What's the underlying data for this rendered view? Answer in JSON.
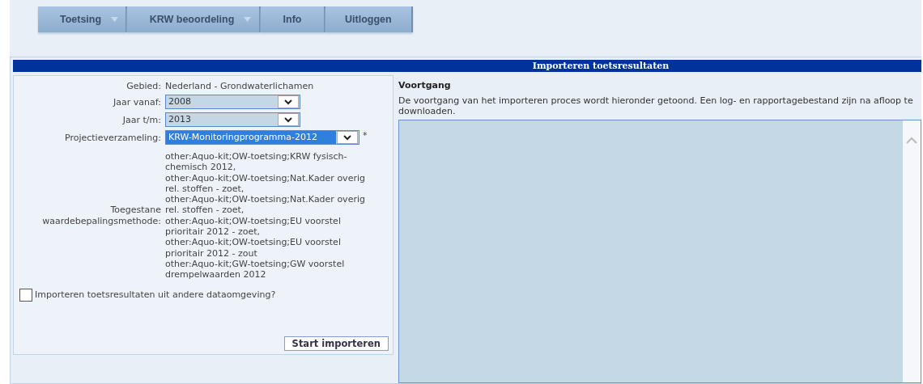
{
  "menu": [
    {
      "label": "Toetsing",
      "has_dropdown": true
    },
    {
      "label": "KRW beoordeling",
      "has_dropdown": true
    },
    {
      "label": "Info",
      "has_dropdown": false
    },
    {
      "label": "Uitloggen",
      "has_dropdown": false
    }
  ],
  "panel_title": "Importeren toetsresultaten",
  "form": {
    "area_label": "Gebied:",
    "area_value": "Nederland - Grondwaterlichamen",
    "selects": [
      {
        "label": "Jaar vanaf:",
        "value": "2008",
        "highlighted": false
      },
      {
        "label": "Jaar t/m:",
        "value": "2013",
        "highlighted": false
      },
      {
        "label": "Projectieverzameling:",
        "value": "KRW-Monitoringprogramma-2012",
        "highlighted": true,
        "required_mark": "*"
      }
    ],
    "methods_label": "Toegestane waardebepalingsmethode:",
    "methods": [
      "other:Aquo-kit;OW-toetsing;KRW fysisch-chemisch 2012,",
      "other:Aquo-kit;OW-toetsing;Nat.Kader overig rel. stoffen - zoet,",
      "other:Aquo-kit;OW-toetsing;Nat.Kader overig rel. stoffen - zoet,",
      "other:Aquo-kit;OW-toetsing;EU voorstel prioritair 2012 - zoet,",
      "other:Aquo-kit;OW-toetsing;EU voorstel prioritair 2012 - zout",
      "other:Aquo-kit;GW-toetsing;GW voorstel drempelwaarden 2012"
    ],
    "checkbox": {
      "label": "Importeren toetsresultaten uit andere dataomgeving?",
      "checked": false
    },
    "submit": "Start importeren"
  },
  "progress": {
    "title": "Voortgang",
    "description": "De voortgang van het importeren proces wordt hieronder getoond. Een log- en rapportagebestand zijn na afloop te downloaden."
  }
}
